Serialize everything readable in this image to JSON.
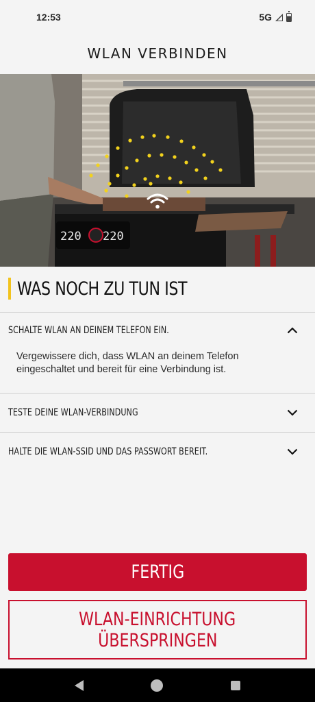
{
  "status_bar": {
    "time": "12:53",
    "network": "5G"
  },
  "header": {
    "title": "WLAN VERBINDEN"
  },
  "section": {
    "heading": "WAS NOCH ZU TUN IST"
  },
  "checklist": [
    {
      "title": "SCHALTE WLAN AN DEINEM TELEFON EIN.",
      "expanded": true,
      "body": "Vergewissere dich, dass WLAN an deinem Telefon eingeschaltet und bereit für eine Verbindung ist."
    },
    {
      "title": "TESTE DEINE WLAN-VERBINDUNG",
      "expanded": false
    },
    {
      "title": "HALTE DIE WLAN-SSID UND DAS PASSWORT BEREIT.",
      "expanded": false
    }
  ],
  "buttons": {
    "done": "FERTIG",
    "skip_line1": "WLAN-EINRICHTUNG",
    "skip_line2": "ÜBERSPRINGEN"
  },
  "grill_display": {
    "left": "220",
    "right": "220"
  },
  "colors": {
    "accent_red": "#c8102e",
    "accent_yellow": "#f2c31d",
    "background": "#f4f4f4"
  },
  "icons": [
    "signal-icon",
    "battery-icon",
    "wifi-icon",
    "chevron-up-icon",
    "chevron-down-icon",
    "back-icon",
    "home-icon",
    "recents-icon"
  ]
}
